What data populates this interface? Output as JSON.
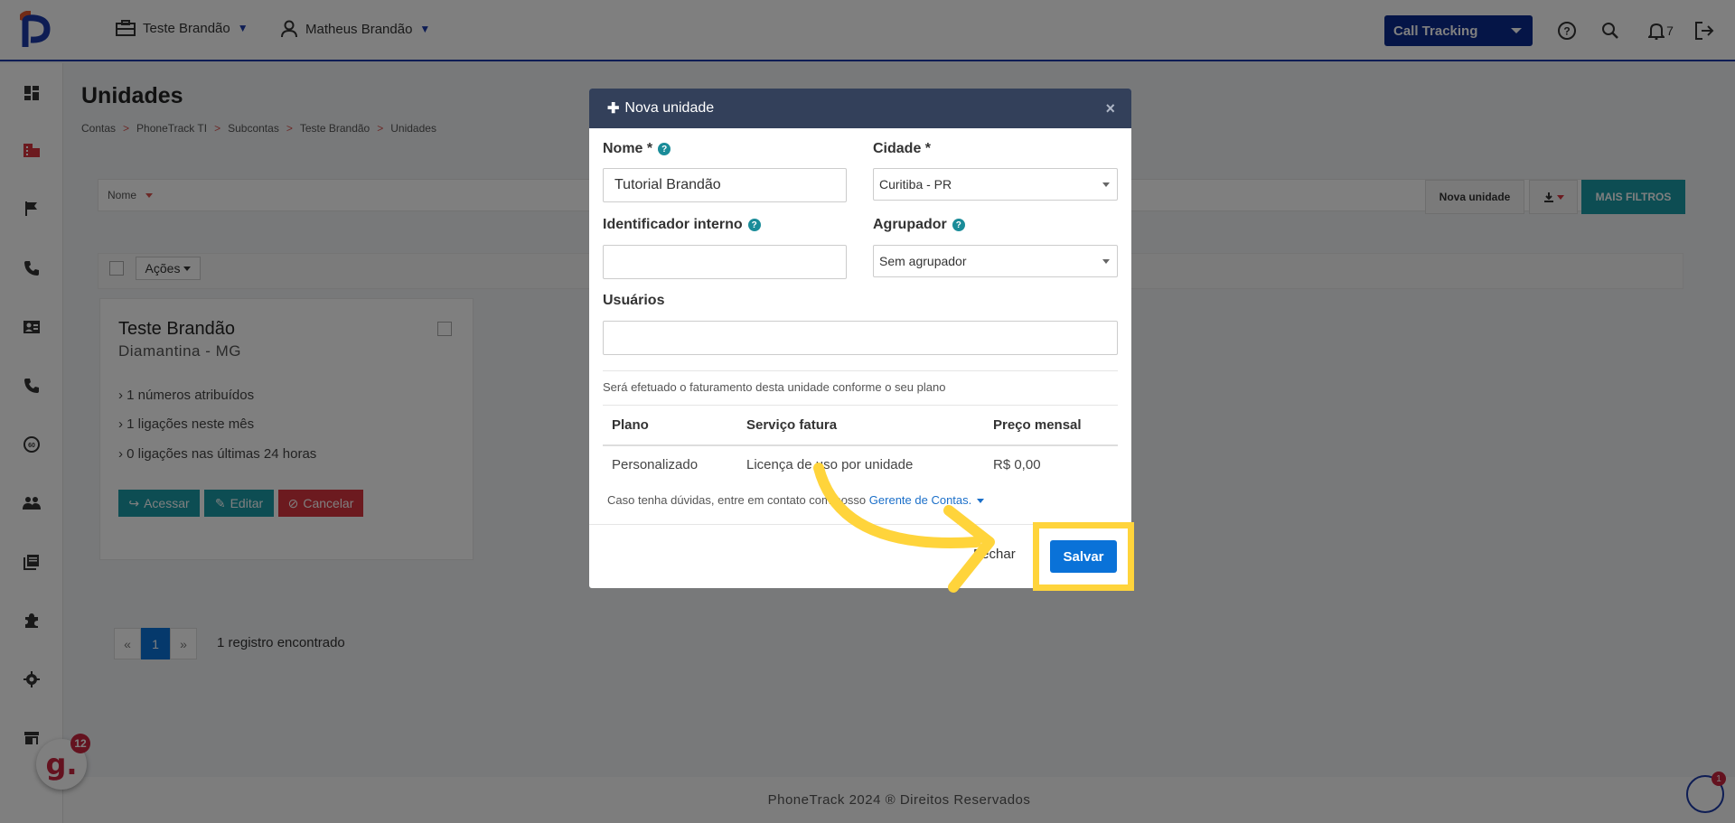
{
  "topbar": {
    "account_label": "Teste Brandão",
    "user_label": "Matheus Brandão",
    "product_select": "Call Tracking",
    "notification_count": "7",
    "icons": [
      "help-icon",
      "search-icon",
      "bell-icon",
      "logout-icon"
    ]
  },
  "sidebar": {
    "icons": [
      "dashboard-icon",
      "accounts-icon",
      "flag-icon",
      "phone-icon",
      "contact-card-icon",
      "phone-icon",
      "speed-icon",
      "users-icon",
      "book-icon",
      "puzzle-icon",
      "gear-icon",
      "store-icon"
    ]
  },
  "page": {
    "title": "Unidades",
    "breadcrumb": [
      "Contas",
      "PhoneTrack TI",
      "Subcontas",
      "Teste Brandão",
      "Unidades"
    ],
    "breadcrumb_sep": ">",
    "filter_label": "Nome",
    "new_unit_button": "Nova unidade",
    "more_filters_button": "MAIS FILTROS",
    "actions_label": "Ações"
  },
  "card": {
    "title": "Teste Brandão",
    "location": "Diamantina - MG",
    "stats": [
      "1 números atribuídos",
      "1 ligações neste mês",
      "0 ligações nas últimas 24 horas"
    ],
    "buttons": {
      "access": "Acessar",
      "edit": "Editar",
      "cancel": "Cancelar"
    }
  },
  "pagination": {
    "prev": "«",
    "current": "1",
    "next": "»",
    "count_text": "1 registro encontrado"
  },
  "footer": {
    "text": "PhoneTrack 2024 ® Direitos Reservados"
  },
  "floating": {
    "g_letter": "g.",
    "g_count": "12",
    "help_count": "1"
  },
  "modal": {
    "title": "Nova unidade",
    "close": "×",
    "name_label": "Nome *",
    "name_value": "Tutorial Brandão",
    "city_label": "Cidade *",
    "city_value": "Curitiba - PR",
    "internal_id_label": "Identificador interno",
    "internal_id_value": "",
    "group_label": "Agrupador",
    "group_value": "Sem agrupador",
    "users_label": "Usuários",
    "billing_note": "Será efetuado o faturamento desta unidade conforme o seu plano",
    "table_headers": [
      "Plano",
      "Serviço fatura",
      "Preço mensal"
    ],
    "table_row": [
      "Personalizado",
      "Licença de uso por unidade",
      "R$ 0,00"
    ],
    "help_text": "Caso tenha dúvidas, entre em contato com nosso",
    "help_link": "Gerente de Contas.",
    "close_button": "Fechar",
    "save_button": "Salvar"
  },
  "colors": {
    "brand": "#1c3aa9",
    "teal": "#1a9aa6",
    "danger": "#d9343f",
    "primary": "#0a72d8",
    "highlight": "#ffd43b"
  }
}
